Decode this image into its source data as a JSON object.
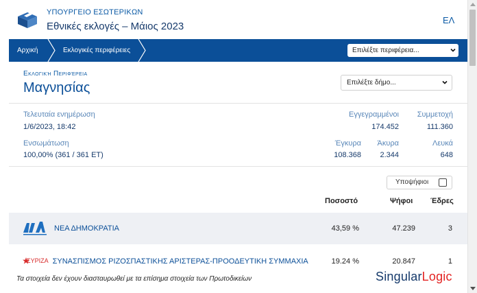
{
  "header": {
    "ministry": "ΥΠΟΥΡΓΕΙΟ ΕΣΩΤΕΡΙΚΩΝ",
    "title": "Εθνικές εκλογές – Μάιος 2023",
    "language": "ΕΛ"
  },
  "nav": {
    "home": "Αρχική",
    "regions": "Εκλογικές περιφέρειες",
    "region_select": "Επιλέξτε περιφέρεια..."
  },
  "region": {
    "label": "Εκλογική Περιφέρεια",
    "name": "Μαγνησίας",
    "municipality_select": "Επιλέξτε δήμο..."
  },
  "stats": {
    "last_update_label": "Τελευταία ενημέρωση",
    "last_update_value": "1/6/2023, 18:42",
    "registered_label": "Εγγεγραμμένοι",
    "registered_value": "174.452",
    "turnout_label": "Συμμετοχή",
    "turnout_value": "111.360",
    "integration_label": "Ενσωμάτωση",
    "integration_value": "100,00% (361 / 361 ΕΤ)",
    "valid_label": "Έγκυρα",
    "valid_value": "108.368",
    "invalid_label": "Άκυρα",
    "invalid_value": "2.344",
    "blank_label": "Λευκά",
    "blank_value": "648"
  },
  "results": {
    "candidates_toggle": "Υποψήφιοι",
    "candidates_checked": false,
    "columns": {
      "percentage": "Ποσοστό",
      "votes": "Ψήφοι",
      "seats": "Έδρες"
    },
    "parties": [
      {
        "logo": "ΝΔ",
        "name": "ΝΕΑ ΔΗΜΟΚΡΑΤΙΑ",
        "percentage": "43,59 %",
        "votes": "47.239",
        "seats": "3"
      },
      {
        "logo": "ΣΥΡΙΖΑ",
        "name": "ΣΥΝΑΣΠΙΣΜΟΣ ΡΙΖΟΣΠΑΣΤΙΚΗΣ ΑΡΙΣΤΕΡΑΣ-ΠΡΟΟΔΕΥΤΙΚΗ ΣΥΜΜΑΧΙΑ",
        "percentage": "19.24 %",
        "votes": "20.847",
        "seats": "1"
      }
    ]
  },
  "footer": {
    "disclaimer": "Τα στοιχεία δεν έχουν διασταυρωθεί με τα επίσημα στοιχεία των Πρωτοδικείων",
    "brand_part1": "Singular",
    "brand_part2": "Logic"
  },
  "colors": {
    "primary": "#0b4f98",
    "accent_red": "#e32322",
    "row_highlight": "#eef0f4"
  }
}
